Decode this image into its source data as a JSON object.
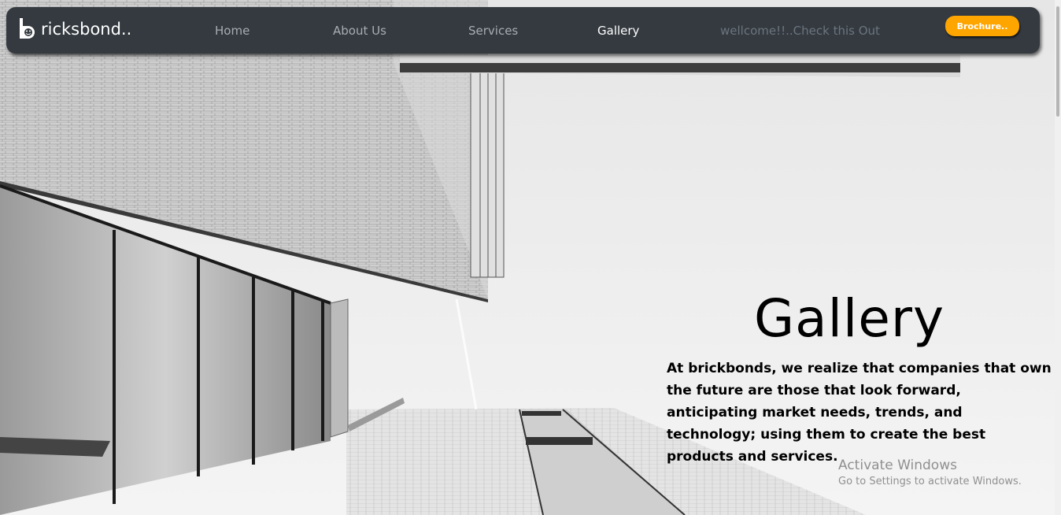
{
  "brand": {
    "name": "ricksbond..",
    "logo_icon": "brick-b-icon"
  },
  "nav": {
    "home": "Home",
    "about": "About Us",
    "services": "Services",
    "gallery": "Gallery",
    "welcome": "wellcome!!..Check this Out"
  },
  "brochure_button": "Brochure..",
  "hero": {
    "title": "Gallery",
    "text": "At brickbonds, we realize that companies that own the future are those that look forward, anticipating market needs, trends, and technology; using them to create the best products and services."
  },
  "watermark": {
    "title": "Activate Windows",
    "subtitle": "Go to Settings to activate Windows."
  },
  "colors": {
    "navbar": "#343a40",
    "accent": "#ffa500",
    "nav_link": "#a8adb3",
    "nav_active": "#ffffff"
  }
}
